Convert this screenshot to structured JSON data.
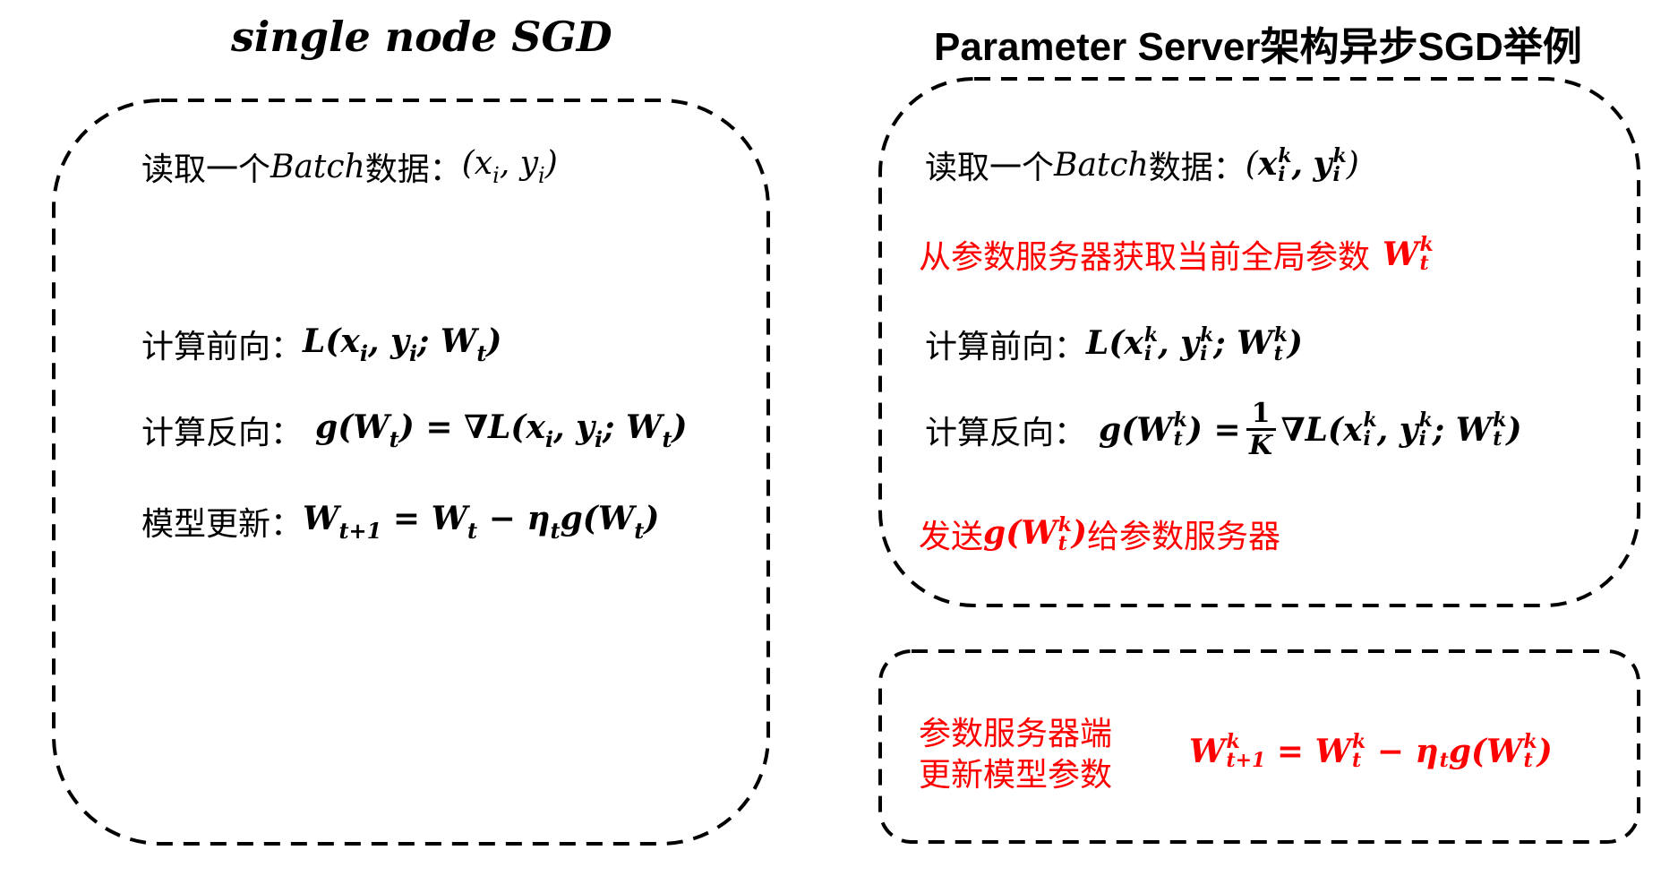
{
  "left_panel": {
    "title": "single node  SGD",
    "step_read_label": "读取一个",
    "batch_word": "Batch",
    "step_read_suffix": "数据：",
    "forward_label": "计算前向：",
    "backward_label": "计算反向：",
    "update_label": "模型更新："
  },
  "right_panel": {
    "title": "Parameter Server架构异步SGD举例",
    "step_read_label": "读取一个",
    "batch_word": "Batch",
    "step_read_suffix": "数据：",
    "fetch_label": "从参数服务器获取当前全局参数",
    "forward_label": "计算前向：",
    "backward_label": "计算反向：",
    "send_prefix": "发送",
    "send_suffix": "给参数服务器",
    "server_label_line1": "参数服务器端",
    "server_label_line2": "更新模型参数"
  },
  "colors": {
    "highlight": "#ff0000",
    "text": "#000000",
    "border": "#000000"
  }
}
